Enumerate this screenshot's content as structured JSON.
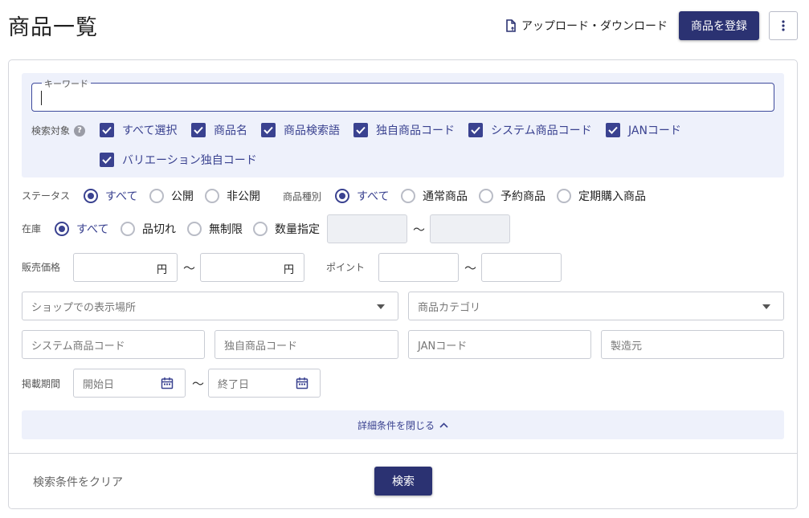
{
  "header": {
    "title": "商品一覧",
    "upload_download_label": "アップロード・ダウンロード",
    "register_label": "商品を登録"
  },
  "search": {
    "keyword_label": "キーワード",
    "keyword_value": "",
    "search_target_label": "検索対象",
    "help_symbol": "?",
    "targets": [
      {
        "label": "すべて選択",
        "checked": true
      },
      {
        "label": "商品名",
        "checked": true
      },
      {
        "label": "商品検索語",
        "checked": true
      },
      {
        "label": "独自商品コード",
        "checked": true
      },
      {
        "label": "システム商品コード",
        "checked": true
      },
      {
        "label": "JANコード",
        "checked": true
      },
      {
        "label": "バリエーション独自コード",
        "checked": true
      }
    ],
    "status": {
      "label": "ステータス",
      "options": [
        "すべて",
        "公開",
        "非公開"
      ],
      "selected": "すべて"
    },
    "product_type": {
      "label": "商品種別",
      "options": [
        "すべて",
        "通常商品",
        "予約商品",
        "定期購入商品"
      ],
      "selected": "すべて"
    },
    "stock": {
      "label": "在庫",
      "options": [
        "すべて",
        "品切れ",
        "無制限",
        "数量指定"
      ],
      "selected": "すべて"
    },
    "range_separator": "～",
    "price": {
      "label": "販売価格",
      "unit": "円",
      "min": "",
      "max": ""
    },
    "point": {
      "label": "ポイント",
      "min": "",
      "max": ""
    },
    "shop_display_placeholder": "ショップでの表示場所",
    "category_placeholder": "商品カテゴリ",
    "system_code_placeholder": "システム商品コード",
    "own_code_placeholder": "独自商品コード",
    "jan_placeholder": "JANコード",
    "maker_placeholder": "製造元",
    "period": {
      "label": "掲載期間",
      "start_placeholder": "開始日",
      "end_placeholder": "終了日"
    },
    "close_detail_label": "詳細条件を閉じる",
    "clear_label": "検索条件をクリア",
    "search_button_label": "検索"
  },
  "colors": {
    "primary": "#2b3272",
    "accent": "#3a4290",
    "panel_bg": "#eef1fb"
  }
}
